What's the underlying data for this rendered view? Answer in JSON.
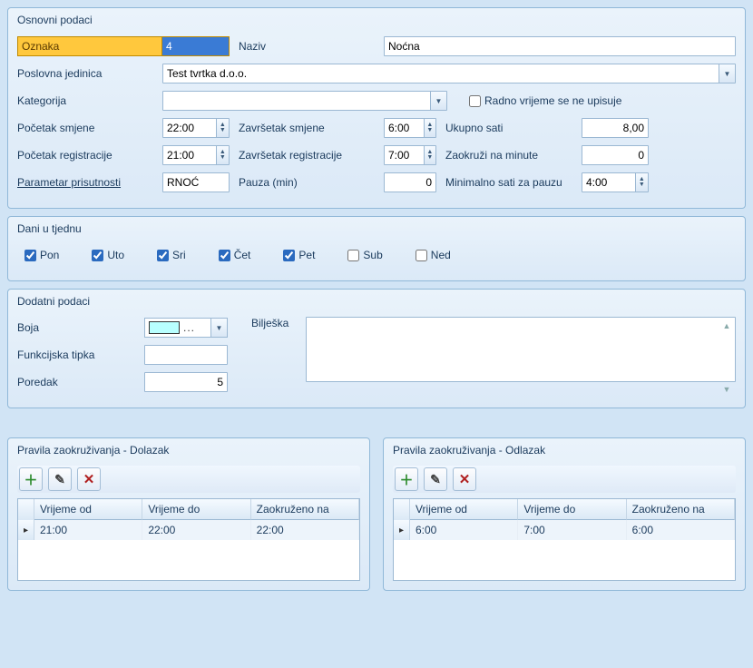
{
  "osnovni": {
    "title": "Osnovni podaci",
    "oznaka_label": "Oznaka",
    "oznaka_value": "4",
    "naziv_label": "Naziv",
    "naziv_value": "Noćna",
    "pj_label": "Poslovna jedinica",
    "pj_value": "Test tvrtka d.o.o.",
    "kategorija_label": "Kategorija",
    "kategorija_value": "",
    "rv_checkbox_label": "Radno vrijeme se ne upisuje",
    "rv_checked": false,
    "pocetak_smjene_label": "Početak smjene",
    "pocetak_smjene_value": "22:00",
    "zavrsetak_smjene_label": "Završetak smjene",
    "zavrsetak_smjene_value": "6:00",
    "ukupno_sati_label": "Ukupno sati",
    "ukupno_sati_value": "8,00",
    "pocetak_reg_label": "Početak registracije",
    "pocetak_reg_value": "21:00",
    "zavrsetak_reg_label": "Završetak registracije",
    "zavrsetak_reg_value": "7:00",
    "zaokruzi_label": "Zaokruži na minute",
    "zaokruzi_value": "0",
    "parametar_label": "Parametar prisutnosti",
    "parametar_value": "RNOĆ",
    "pauza_label": "Pauza (min)",
    "pauza_value": "0",
    "min_sati_pauza_label": "Minimalno sati za pauzu",
    "min_sati_pauza_value": "4:00"
  },
  "dani": {
    "title": "Dani u tjednu",
    "items": [
      {
        "label": "Pon",
        "checked": true
      },
      {
        "label": "Uto",
        "checked": true
      },
      {
        "label": "Sri",
        "checked": true
      },
      {
        "label": "Čet",
        "checked": true
      },
      {
        "label": "Pet",
        "checked": true
      },
      {
        "label": "Sub",
        "checked": false
      },
      {
        "label": "Ned",
        "checked": false
      }
    ]
  },
  "dodatni": {
    "title": "Dodatni podaci",
    "boja_label": "Boja",
    "boja_value": "#b8ffff",
    "ft_label": "Funkcijska tipka",
    "ft_value": "",
    "poredak_label": "Poredak",
    "poredak_value": "5",
    "biljeska_label": "Bilješka",
    "biljeska_value": ""
  },
  "dolazak": {
    "title": "Pravila zaokruživanja - Dolazak",
    "cols": [
      "Vrijeme od",
      "Vrijeme do",
      "Zaokruženo na"
    ],
    "rows": [
      {
        "od": "21:00",
        "do": "22:00",
        "na": "22:00"
      }
    ]
  },
  "odlazak": {
    "title": "Pravila zaokruživanja - Odlazak",
    "cols": [
      "Vrijeme od",
      "Vrijeme do",
      "Zaokruženo na"
    ],
    "rows": [
      {
        "od": "6:00",
        "do": "7:00",
        "na": "6:00"
      }
    ]
  },
  "picker_dots": "..."
}
